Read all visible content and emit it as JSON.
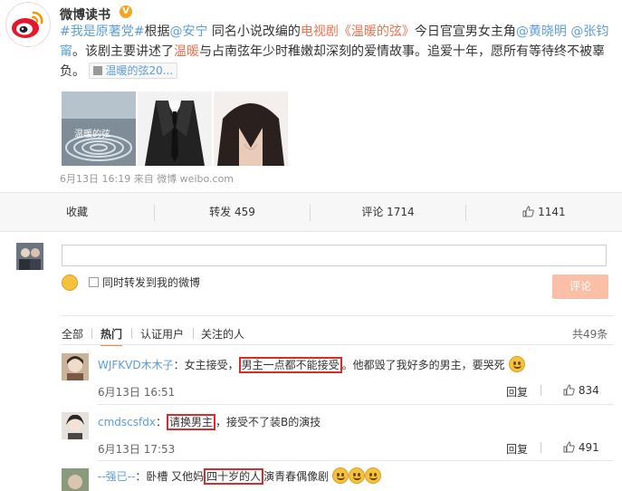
{
  "post": {
    "author": "微博读书",
    "verified_badge": "V",
    "text": {
      "topic": "#我是原著党#",
      "p1": "根据",
      "mention_author": "@安宁",
      "p2": " 同名小说改编的",
      "tv_label": "电视剧",
      "book_title": "《温暖的弦》",
      "p3": "今日官宣男女主角",
      "mention_actor1": "@黄晓明",
      "sp": " ",
      "mention_actor2_a": "@张钧",
      "mention_actor2_b": "甯",
      "p4": "。该剧主要讲述了",
      "char_name": "温暖",
      "p5": "与占南弦年少时稚嫩却深刻的爱情故事。追爱十年，愿所有等待终不被辜负。",
      "card_link": "温暖的弦20..."
    },
    "images": [
      {
        "name": "poster-image",
        "caption": "温暖的弦"
      },
      {
        "name": "actor-image",
        "caption": ""
      },
      {
        "name": "actress-image",
        "caption": ""
      }
    ],
    "meta": "6月13日 16:19 来自 微博 weibo.com"
  },
  "actions": {
    "collect": "收藏",
    "repost": "转发 459",
    "comment": "评论 1714",
    "like": "1141"
  },
  "composer": {
    "input_placeholder": "",
    "also_repost_label": "同时转发到我的微博",
    "submit_label": "评论"
  },
  "filters": {
    "tabs": [
      "全部",
      "热门",
      "认证用户",
      "关注的人"
    ],
    "active": "热门",
    "total": "共49条"
  },
  "comments": [
    {
      "user": "WJFKVD木木子",
      "before": "：女主接受，",
      "boxed": "男主一点都不能接受",
      "after": "。他都毁了我好多的男主，要哭死",
      "time": "6月13日 16:51",
      "reply": "回复",
      "likes": "834"
    },
    {
      "user": "cmdscsfdx",
      "before": "：",
      "boxed": "请换男主",
      "after": "，接受不了装B的演技",
      "time": "6月13日 17:53",
      "reply": "回复",
      "likes": "491"
    },
    {
      "user": "--强已--",
      "before": "：卧槽 又他妈",
      "boxed": "四十岁的人",
      "after": "演青春偶像剧",
      "time": "",
      "reply": "",
      "likes": ""
    }
  ],
  "colors": {
    "accent": "#eb7350",
    "link": "#5d9dd6",
    "highlight_box": "#d92b2b",
    "submit_bg": "#fbbfa7"
  }
}
